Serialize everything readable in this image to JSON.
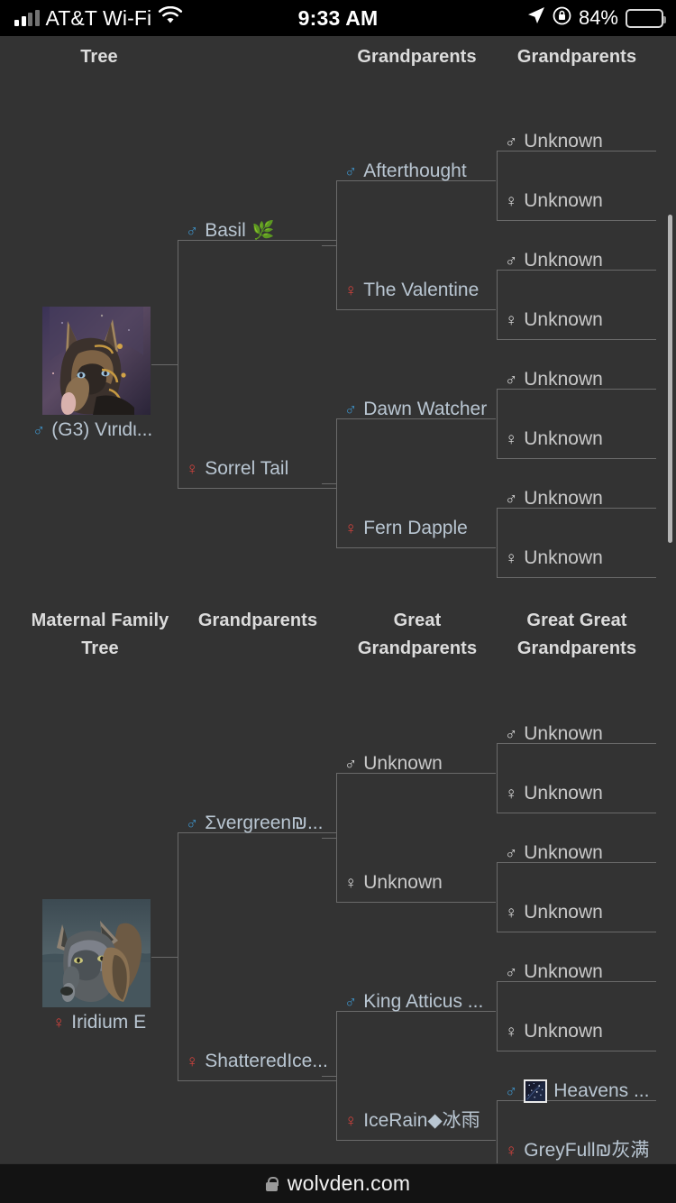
{
  "status_bar": {
    "carrier": "AT&T Wi-Fi",
    "time": "9:33 AM",
    "battery_percent": "84%",
    "icons": [
      "signal-bars-icon",
      "wifi-icon",
      "location-arrow-icon",
      "orientation-lock-icon",
      "battery-icon"
    ]
  },
  "browser_bar": {
    "url": "wolvden.com",
    "lock_icon": "lock-icon"
  },
  "paternal_tree": {
    "headers": [
      {
        "label": "Tree"
      },
      {
        "label": ""
      },
      {
        "label": "Grandparents"
      },
      {
        "label": "Grandparents"
      }
    ],
    "subject": {
      "name": "(G3) Vιrιdι...",
      "sex": "male",
      "symbol": "♂",
      "portrait_alt": "wolf-portrait-dark-tan"
    },
    "parents": [
      {
        "name": "Basil",
        "sex": "male",
        "symbol": "♂",
        "emoji": "🌿"
      },
      {
        "name": "Sorrel Tail",
        "sex": "female",
        "symbol": "♀",
        "emoji": ""
      }
    ],
    "grandparents": [
      {
        "name": "Afterthought",
        "sex": "male",
        "symbol": "♂"
      },
      {
        "name": "The Valentine",
        "sex": "female",
        "symbol": "♀"
      },
      {
        "name": "Dawn Watcher",
        "sex": "male",
        "symbol": "♂"
      },
      {
        "name": "Fern Dapple",
        "sex": "female",
        "symbol": "♀"
      }
    ],
    "great_grandparents": [
      {
        "name": "Unknown",
        "sex": "male",
        "symbol": "♂"
      },
      {
        "name": "Unknown",
        "sex": "female",
        "symbol": "♀"
      },
      {
        "name": "Unknown",
        "sex": "male",
        "symbol": "♂"
      },
      {
        "name": "Unknown",
        "sex": "female",
        "symbol": "♀"
      },
      {
        "name": "Unknown",
        "sex": "male",
        "symbol": "♂"
      },
      {
        "name": "Unknown",
        "sex": "female",
        "symbol": "♀"
      },
      {
        "name": "Unknown",
        "sex": "male",
        "symbol": "♂"
      },
      {
        "name": "Unknown",
        "sex": "female",
        "symbol": "♀"
      }
    ]
  },
  "maternal_tree": {
    "headers": [
      {
        "label": "Maternal Family Tree"
      },
      {
        "label": "Grandparents"
      },
      {
        "label": "Great Grandparents"
      },
      {
        "label": "Great Great Grandparents"
      }
    ],
    "subject": {
      "name": "Iridium E",
      "sex": "female",
      "symbol": "♀",
      "portrait_alt": "wolf-portrait-grey-blue"
    },
    "parents": [
      {
        "name": "Σvergreen₪...",
        "sex": "male",
        "symbol": "♂"
      },
      {
        "name": "ShatteredIce...",
        "sex": "female",
        "symbol": "♀"
      }
    ],
    "grandparents": [
      {
        "name": "Unknown",
        "sex": "male",
        "symbol": "♂"
      },
      {
        "name": "Unknown",
        "sex": "female",
        "symbol": "♀"
      },
      {
        "name": "King Atticus ...",
        "sex": "male",
        "symbol": "♂"
      },
      {
        "name": "IceRain◆冰雨",
        "sex": "female",
        "symbol": "♀"
      }
    ],
    "great_grandparents": [
      {
        "name": "Unknown",
        "sex": "male",
        "symbol": "♂",
        "chip": false
      },
      {
        "name": "Unknown",
        "sex": "female",
        "symbol": "♀",
        "chip": false
      },
      {
        "name": "Unknown",
        "sex": "male",
        "symbol": "♂",
        "chip": false
      },
      {
        "name": "Unknown",
        "sex": "female",
        "symbol": "♀",
        "chip": false
      },
      {
        "name": "Unknown",
        "sex": "male",
        "symbol": "♂",
        "chip": false
      },
      {
        "name": "Unknown",
        "sex": "female",
        "symbol": "♀",
        "chip": false
      },
      {
        "name": "Heavens ...",
        "sex": "male",
        "symbol": "♂",
        "chip": true
      },
      {
        "name": "GreyFull₪灰满",
        "sex": "female",
        "symbol": "♀",
        "chip": false
      }
    ]
  },
  "colors": {
    "background": "#333333",
    "male": "#3e90c4",
    "female": "#d0423c",
    "name_text": "#b9c6d2",
    "unknown_text": "#c9c9c9",
    "header_text": "#dcdcdc",
    "bracket_line": "#6a6a6a",
    "scrollbar": "#b4b4b4"
  },
  "scrollbar": {
    "label": "vertical-scrollbar"
  }
}
